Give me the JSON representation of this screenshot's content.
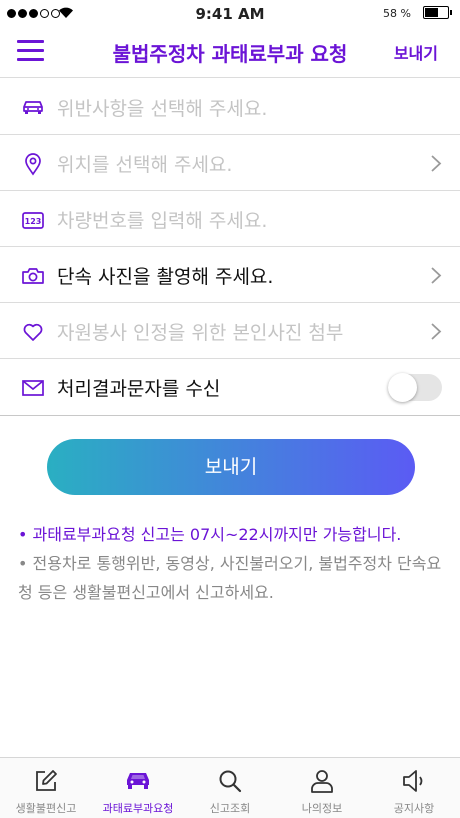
{
  "status_bar": {
    "time": "9:41 AM",
    "battery": "58 %"
  },
  "header": {
    "title": "불법주정차 과태료부과 요청",
    "send_label": "보내기"
  },
  "rows": [
    {
      "label": "위반사항을 선택해 주세요.",
      "icon": "car-icon"
    },
    {
      "label": "위치를 선택해 주세요.",
      "icon": "location-pin-icon"
    },
    {
      "label": "차량번호를 입력해 주세요.",
      "icon": "plate-number-icon",
      "icon_text": "123"
    },
    {
      "label": "단속 사진을 촬영해 주세요.",
      "icon": "camera-icon"
    },
    {
      "label": "자원봉사 인정을 위한 본인사진 첨부",
      "icon": "heart-icon"
    },
    {
      "label": "처리결과문자를 수신",
      "icon": "mail-icon",
      "toggle_on": false
    }
  ],
  "send_button": {
    "label": "보내기"
  },
  "notes": {
    "line1": "• 과태료부과요청 신고는 07시~22시까지만 가능합니다.",
    "line2": "• 전용차로 통행위반, 동영상, 사진불러오기, 불법주정차 단속요청 등은 생활불편신고에서 신고하세요."
  },
  "tabs": [
    {
      "label": "생활불편신고",
      "icon": "edit-icon"
    },
    {
      "label": "과태료부과요청",
      "icon": "car-icon",
      "active": true
    },
    {
      "label": "신고조회",
      "icon": "search-icon"
    },
    {
      "label": "나의정보",
      "icon": "user-icon"
    },
    {
      "label": "공지사항",
      "icon": "speaker-icon"
    }
  ],
  "colors": {
    "accent": "#6b14d6",
    "gradient_start": "#2aafc2",
    "gradient_end": "#5b5bf4"
  }
}
